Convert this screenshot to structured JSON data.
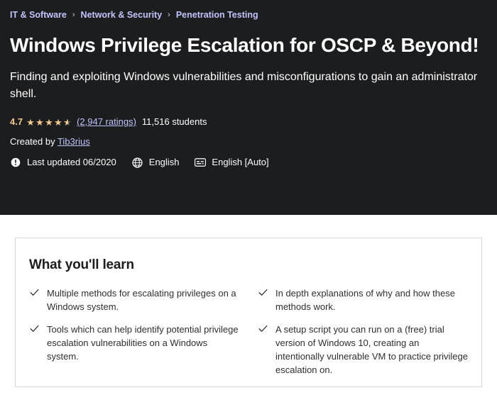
{
  "colors": {
    "hero_bg": "#1c1d1f",
    "link_purple": "#c0c4fc",
    "star_gold": "#f3ca8c",
    "page_bg": "#ffffff",
    "card_border": "#d1d7dc",
    "body_text": "#2d2f31"
  },
  "breadcrumb": {
    "items": [
      {
        "label": "IT & Software"
      },
      {
        "label": "Network & Security"
      },
      {
        "label": "Penetration Testing"
      }
    ],
    "separator": "›"
  },
  "hero": {
    "title": "Windows Privilege Escalation for OSCP & Beyond!",
    "subtitle": "Finding and exploiting Windows vulnerabilities and misconfigurations to gain an administrator shell.",
    "rating": {
      "value": "4.7",
      "stars_filled": 4,
      "has_half_star": true,
      "star_glyph": "★",
      "ratings_link": "(2,947 ratings)",
      "students": "11,516 students"
    },
    "created_by": {
      "prefix": "Created by ",
      "author": "Tib3rius "
    },
    "meta": [
      {
        "icon": "info-circle-icon",
        "label": "Last updated 06/2020"
      },
      {
        "icon": "globe-icon",
        "label": "English"
      },
      {
        "icon": "closed-caption-icon",
        "label": "English [Auto]"
      }
    ]
  },
  "learn_card": {
    "title": "What you'll learn",
    "check_glyph": "✓",
    "columns": [
      {
        "items": [
          "Multiple methods for escalating privileges on a Windows system.",
          "Tools which can help identify potential privilege escalation vulnerabilities on a Windows system."
        ]
      },
      {
        "items": [
          "In depth explanations of why and how these methods work.",
          "A setup script you can run on a (free) trial version of Windows 10, creating an intentionally vulnerable VM to practice privilege escalation on."
        ]
      }
    ]
  }
}
